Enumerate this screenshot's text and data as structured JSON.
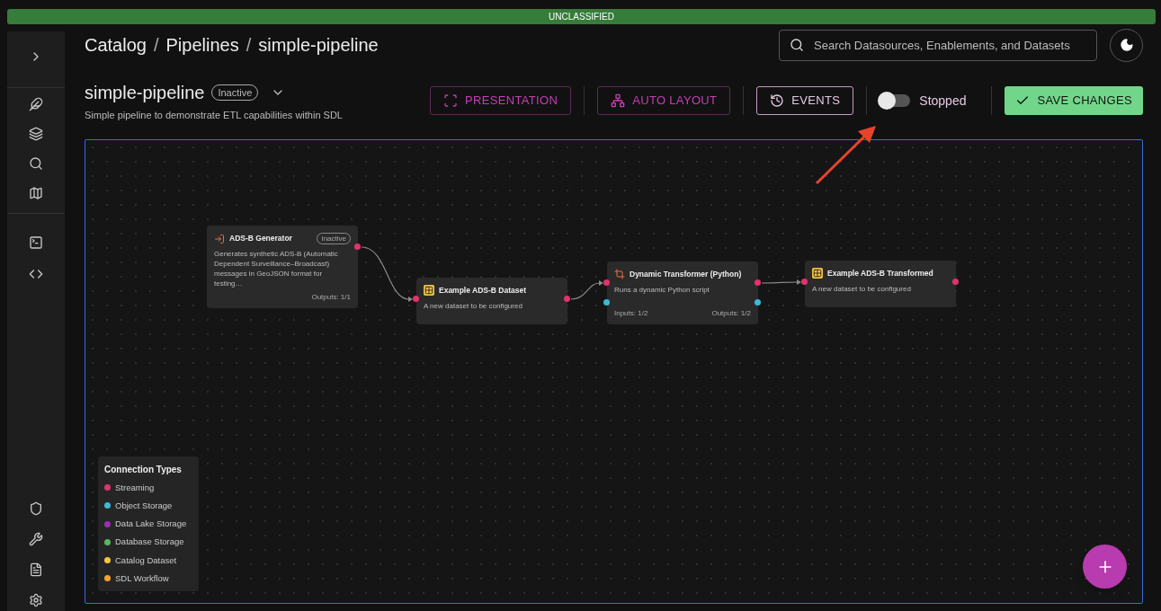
{
  "banner": {
    "text": "UNCLASSIFIED"
  },
  "breadcrumbs": [
    {
      "kind": "link",
      "text": "Catalog"
    },
    {
      "kind": "separator",
      "text": "/"
    },
    {
      "kind": "link",
      "text": "Pipelines"
    },
    {
      "kind": "separator",
      "text": "/"
    },
    {
      "kind": "current",
      "text": "simple-pipeline"
    }
  ],
  "search": {
    "placeholder": "Search Datasources, Enablements, and Datasets"
  },
  "pipeline": {
    "name": "simple-pipeline",
    "status": "Inactive",
    "description": "Simple pipeline to demonstrate ETL capabilities within SDL"
  },
  "toolbar": [
    {
      "kind": "presentation",
      "label": "PRESENTATION",
      "selected": false
    },
    {
      "kind": "layout",
      "label": "AUTO LAYOUT",
      "selected": false
    },
    {
      "kind": "events",
      "label": "EVENTS",
      "selected": true
    }
  ],
  "run_toggle": {
    "on": false,
    "label": "Stopped"
  },
  "save_button": {
    "label": "SAVE CHANGES"
  },
  "nodes": [
    {
      "kind": "source",
      "title": "ADS-B Generator",
      "badge": "Inactive",
      "description": "Generates synthetic ADS-B (Automatic Dependent Surveillance–Broadcast) messages in GeoJSON format for testing…",
      "footer_right": "Outputs: 1/1",
      "ports": [
        {
          "color": "#e0336f"
        }
      ]
    },
    {
      "kind": "dataset",
      "title": "Example ADS-B Dataset",
      "description": "A new dataset to be configured",
      "ports": [
        {
          "color": "#e0336f"
        },
        {
          "color": "#e0336f"
        }
      ]
    },
    {
      "kind": "transformer",
      "title": "Dynamic Transformer (Python)",
      "description": "Runs a dynamic Python script",
      "footer_left": "Inputs: 1/2",
      "footer_right": "Outputs: 1/2",
      "ports": [
        {
          "color": "#e0336f"
        },
        {
          "color": "#e0336f"
        },
        {
          "color": "#3db9d8"
        },
        {
          "color": "#3db9d8"
        }
      ]
    },
    {
      "kind": "dataset",
      "title": "Example ADS-B Transformed",
      "description": "A new dataset to be configured",
      "ports": [
        {
          "color": "#e0336f"
        },
        {
          "color": "#e0336f"
        }
      ]
    }
  ],
  "legend": {
    "title": "Connection Types",
    "items": [
      {
        "label": "Streaming",
        "color": "#e0336f"
      },
      {
        "label": "Object Storage",
        "color": "#3db9d8"
      },
      {
        "label": "Data Lake Storage",
        "color": "#9c2fb0"
      },
      {
        "label": "Database Storage",
        "color": "#5cb85c"
      },
      {
        "label": "Catalog Dataset",
        "color": "#f5c542"
      },
      {
        "label": "SDL Workflow",
        "color": "#f5a030"
      }
    ]
  }
}
